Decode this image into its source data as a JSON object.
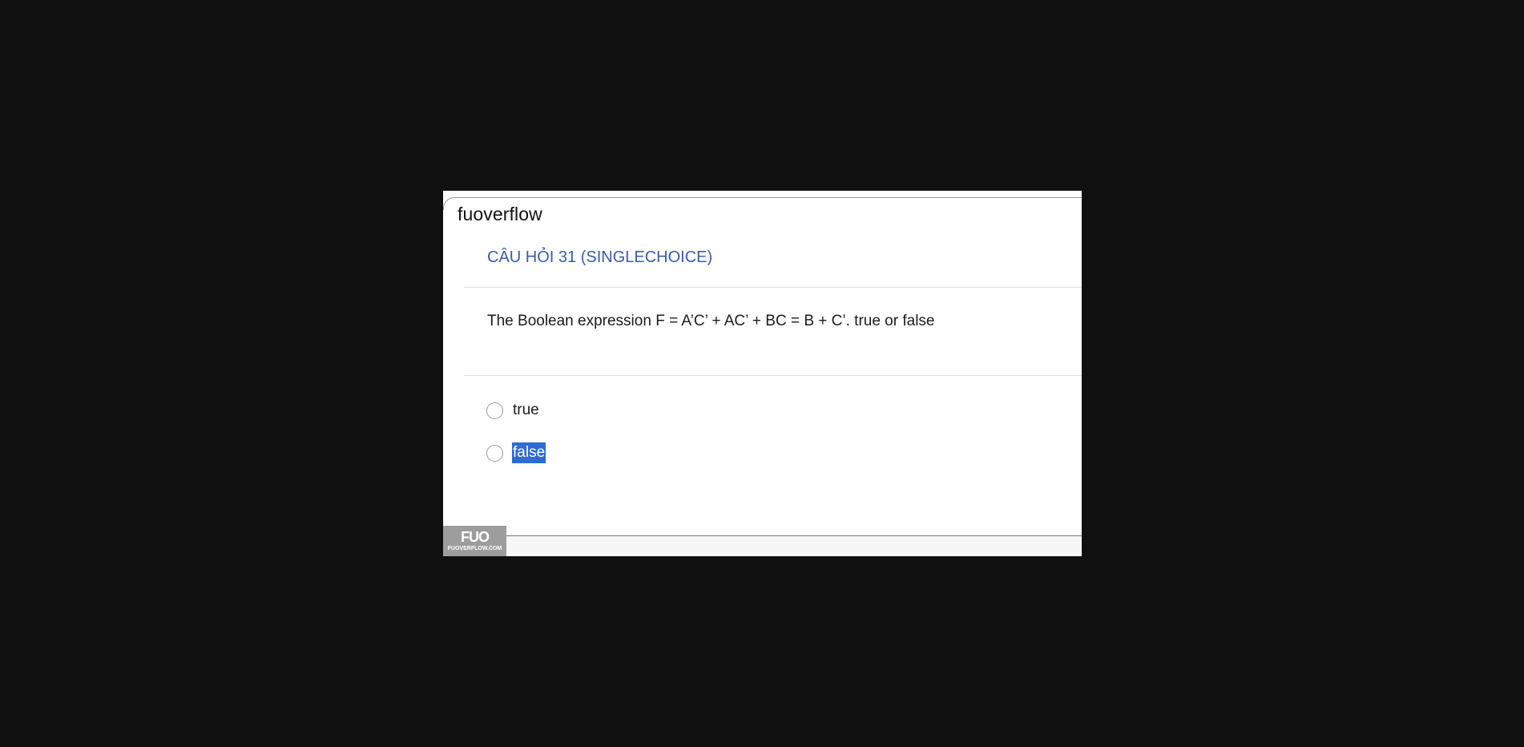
{
  "site": {
    "title": "fuoverflow"
  },
  "question": {
    "heading": "CÂU HỎI 31 (SINGLECHOICE)",
    "text": "The Boolean expression F = A’C’ + AC’ + BC = B + C’. true or false"
  },
  "options": [
    {
      "label": "true",
      "selected": false
    },
    {
      "label": "false",
      "selected": false,
      "highlighted": true
    }
  ],
  "watermark": {
    "mark": "FUO",
    "caption": "FUOVERFLOW.COM"
  },
  "colors": {
    "background": "#101010",
    "heading": "#3a5ca8",
    "highlight": "#2f6bd2"
  }
}
